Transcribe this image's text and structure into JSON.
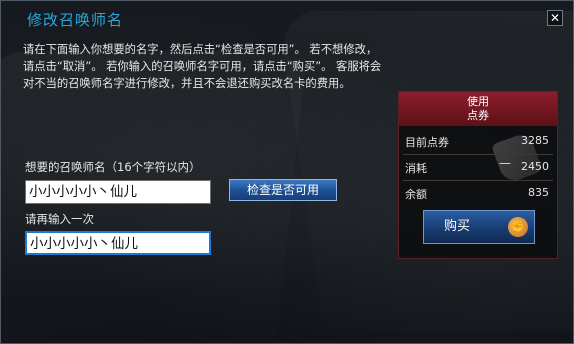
{
  "dialog": {
    "title": "修改召唤师名",
    "close_label": "✕"
  },
  "description": "请在下面输入你想要的名字，然后点击“检查是否可用”。 若不想修改，请点击“取消”。 若你输入的召唤师名字可用，请点击“购买”。 客服将会对不当的召唤师名字进行修改，并且不会退还购买改名卡的费用。",
  "form": {
    "name_label": "想要的召唤师名（16个字符以内）",
    "name_value": "小小小小小丶仙儿",
    "check_button": "检查是否可用",
    "confirm_label": "请再输入一次",
    "confirm_value": "小小小小小丶仙儿"
  },
  "purchase": {
    "header_line1": "使用",
    "header_line2": "点券",
    "rows": [
      {
        "label": "目前点券",
        "value": "3285"
      },
      {
        "label": "消耗",
        "value": "2450"
      },
      {
        "label": "余额",
        "value": "835"
      }
    ],
    "minus_sign": "—",
    "buy_button": "购买",
    "icon": "fist-coin-icon",
    "colors": {
      "header": "#8c1f2b",
      "accent": "#2aa7d6"
    }
  }
}
